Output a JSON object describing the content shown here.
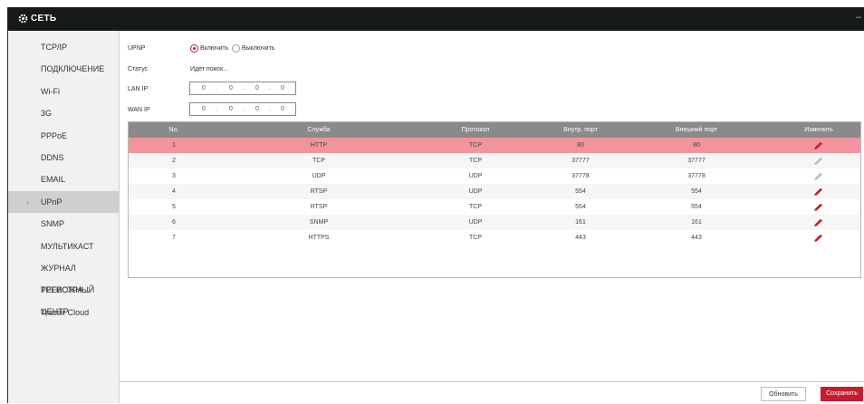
{
  "window": {
    "title": "СЕТЬ",
    "minimize": "–"
  },
  "sidebar": {
    "items": [
      {
        "label": "TCP/IP"
      },
      {
        "label": "ПОДКЛЮЧЕНИЕ"
      },
      {
        "label": "Wi-Fi"
      },
      {
        "label": "3G"
      },
      {
        "label": "PPPoE"
      },
      {
        "label": "DDNS"
      },
      {
        "label": "EMAIL"
      },
      {
        "label": "UPnP",
        "active": true
      },
      {
        "label": "SNMP"
      },
      {
        "label": "МУЛЬТИКАСТ"
      },
      {
        "label": "ЖУРНАЛ РЕГИСТРА..."
      },
      {
        "label": "ТРЕВОЖНЫЙ ЦЕНТР"
      },
      {
        "label": "Trassir Cloud"
      }
    ]
  },
  "form": {
    "upnp_label": "UPNP",
    "enable_label": "Включить",
    "disable_label": "Выключить",
    "enabled": true,
    "status_label": "Статус",
    "status_value": "Идет поиск...",
    "lan_ip_label": "LAN IP",
    "lan_ip": [
      "0",
      "0",
      "0",
      "0"
    ],
    "wan_ip_label": "WAN IP",
    "wan_ip": [
      "0",
      "0",
      "0",
      "0"
    ]
  },
  "table": {
    "headers": [
      "No.",
      "Служба",
      "Протокол",
      "Внутр. порт",
      "Внешний порт",
      "Изменить"
    ],
    "rows": [
      {
        "no": "1",
        "service": "HTTP",
        "protocol": "TCP",
        "internal": "80",
        "external": "80",
        "editable": true,
        "selected": true
      },
      {
        "no": "2",
        "service": "TCP",
        "protocol": "TCP",
        "internal": "37777",
        "external": "37777",
        "editable": false
      },
      {
        "no": "3",
        "service": "UDP",
        "protocol": "UDP",
        "internal": "37778",
        "external": "37778",
        "editable": false
      },
      {
        "no": "4",
        "service": "RTSP",
        "protocol": "UDP",
        "internal": "554",
        "external": "554",
        "editable": true
      },
      {
        "no": "5",
        "service": "RTSP",
        "protocol": "TCP",
        "internal": "554",
        "external": "554",
        "editable": true
      },
      {
        "no": "6",
        "service": "SNMP",
        "protocol": "UDP",
        "internal": "161",
        "external": "161",
        "editable": true
      },
      {
        "no": "7",
        "service": "HTTPS",
        "protocol": "TCP",
        "internal": "443",
        "external": "443",
        "editable": true
      }
    ]
  },
  "buttons": {
    "refresh": "Обновить",
    "save": "Сохранить"
  },
  "colors": {
    "accent": "#c41d2f",
    "selected_row": "#f2949d",
    "header": "#8a8a8a",
    "titlebar": "#15191a",
    "pencil_active": "#c41d2f",
    "pencil_disabled": "#bdbdbd"
  }
}
